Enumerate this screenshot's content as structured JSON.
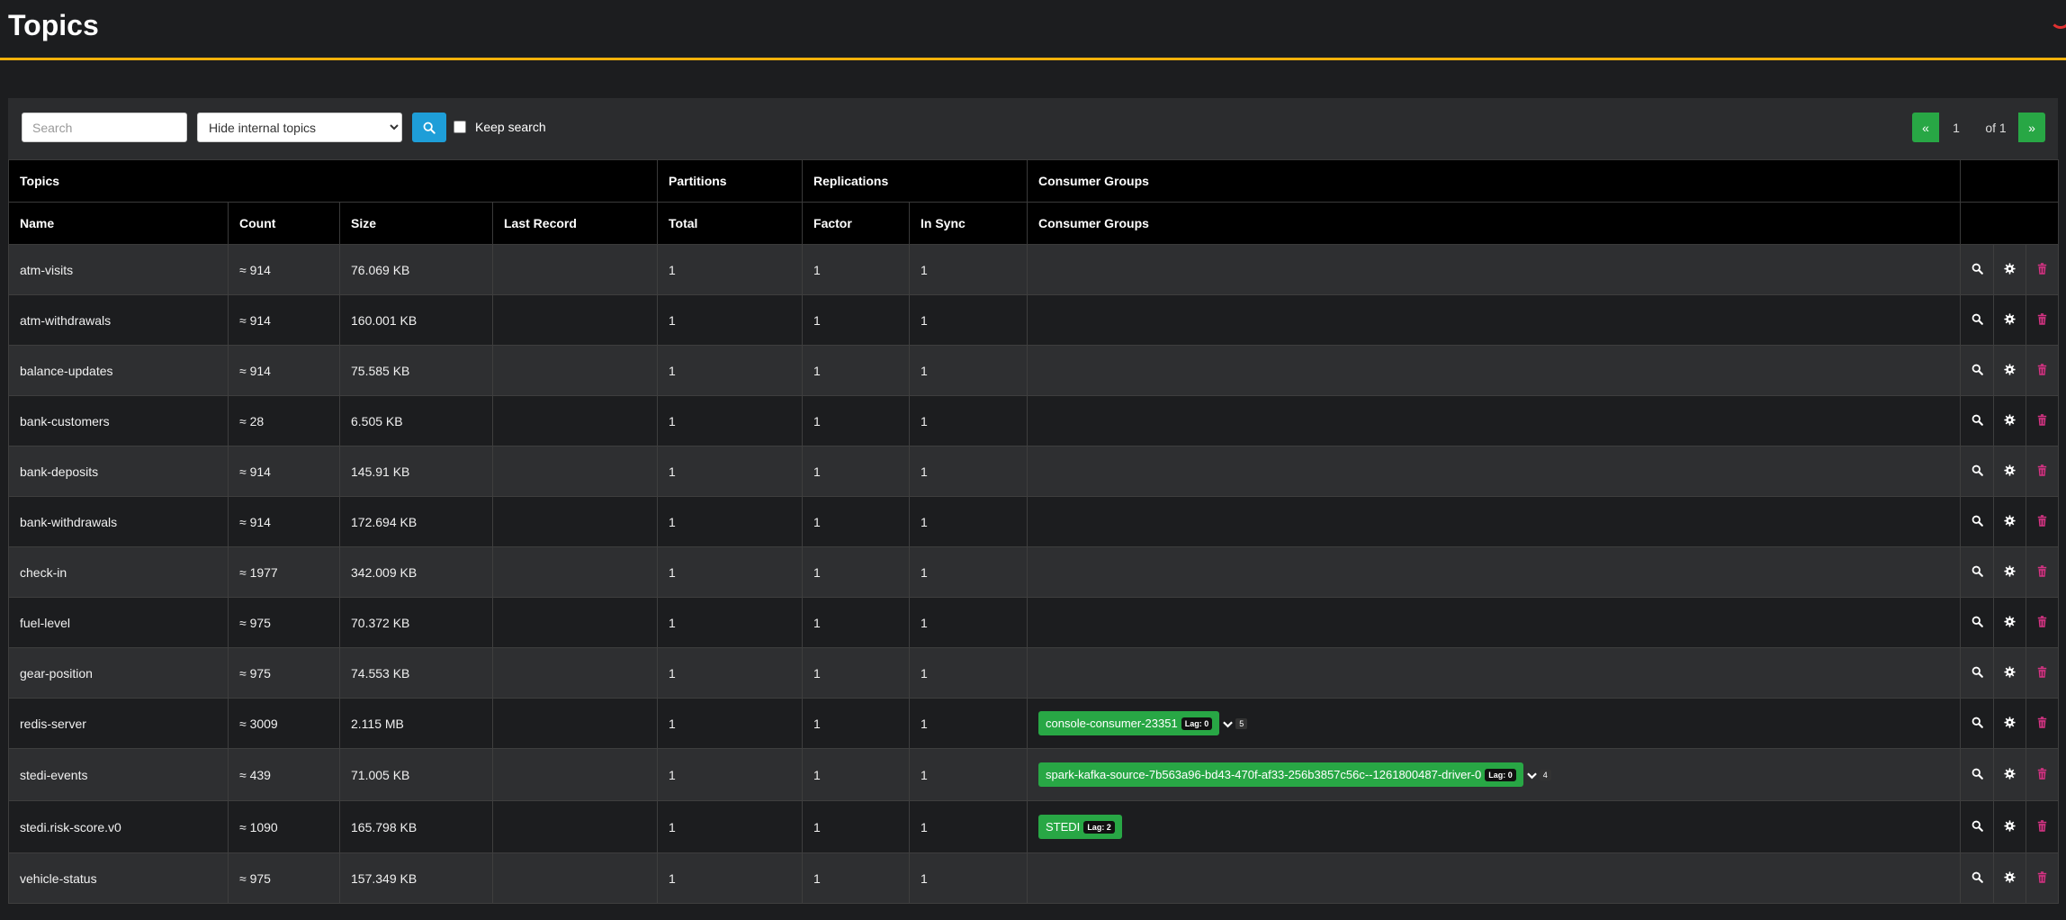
{
  "page": {
    "title": "Topics"
  },
  "toolbar": {
    "search_placeholder": "Search",
    "filter_selected": "Hide internal topics",
    "keep_search_label": "Keep search",
    "keep_search_checked": false
  },
  "pagination": {
    "prev": "«",
    "current": "1",
    "of_label": "of 1",
    "next": "»"
  },
  "table": {
    "group_headers": [
      "Topics",
      "Partitions",
      "Replications",
      "Consumer Groups"
    ],
    "column_headers": [
      "Name",
      "Count",
      "Size",
      "Last Record",
      "Total",
      "Factor",
      "In Sync",
      "Consumer Groups"
    ],
    "rows": [
      {
        "name": "atm-visits",
        "count": "≈ 914",
        "size": "76.069 KB",
        "last_record": "",
        "total": "1",
        "factor": "1",
        "in_sync": "1",
        "consumer_groups": []
      },
      {
        "name": "atm-withdrawals",
        "count": "≈ 914",
        "size": "160.001 KB",
        "last_record": "",
        "total": "1",
        "factor": "1",
        "in_sync": "1",
        "consumer_groups": []
      },
      {
        "name": "balance-updates",
        "count": "≈ 914",
        "size": "75.585 KB",
        "last_record": "",
        "total": "1",
        "factor": "1",
        "in_sync": "1",
        "consumer_groups": []
      },
      {
        "name": "bank-customers",
        "count": "≈ 28",
        "size": "6.505 KB",
        "last_record": "",
        "total": "1",
        "factor": "1",
        "in_sync": "1",
        "consumer_groups": []
      },
      {
        "name": "bank-deposits",
        "count": "≈ 914",
        "size": "145.91 KB",
        "last_record": "",
        "total": "1",
        "factor": "1",
        "in_sync": "1",
        "consumer_groups": []
      },
      {
        "name": "bank-withdrawals",
        "count": "≈ 914",
        "size": "172.694 KB",
        "last_record": "",
        "total": "1",
        "factor": "1",
        "in_sync": "1",
        "consumer_groups": []
      },
      {
        "name": "check-in",
        "count": "≈ 1977",
        "size": "342.009 KB",
        "last_record": "",
        "total": "1",
        "factor": "1",
        "in_sync": "1",
        "consumer_groups": []
      },
      {
        "name": "fuel-level",
        "count": "≈ 975",
        "size": "70.372 KB",
        "last_record": "",
        "total": "1",
        "factor": "1",
        "in_sync": "1",
        "consumer_groups": []
      },
      {
        "name": "gear-position",
        "count": "≈ 975",
        "size": "74.553 KB",
        "last_record": "",
        "total": "1",
        "factor": "1",
        "in_sync": "1",
        "consumer_groups": []
      },
      {
        "name": "redis-server",
        "count": "≈ 3009",
        "size": "2.115 MB",
        "last_record": "",
        "total": "1",
        "factor": "1",
        "in_sync": "1",
        "consumer_groups": [
          {
            "name": "console-consumer-23351",
            "lag": "Lag: 0"
          }
        ],
        "more_count": "5"
      },
      {
        "name": "stedi-events",
        "count": "≈ 439",
        "size": "71.005 KB",
        "last_record": "",
        "total": "1",
        "factor": "1",
        "in_sync": "1",
        "consumer_groups": [
          {
            "name": "spark-kafka-source-7b563a96-bd43-470f-af33-256b3857c56c--1261800487-driver-0",
            "lag": "Lag: 0"
          }
        ],
        "more_count": "4"
      },
      {
        "name": "stedi.risk-score.v0",
        "count": "≈ 1090",
        "size": "165.798 KB",
        "last_record": "",
        "total": "1",
        "factor": "1",
        "in_sync": "1",
        "consumer_groups": [
          {
            "name": "STEDI",
            "lag": "Lag: 2"
          }
        ]
      },
      {
        "name": "vehicle-status",
        "count": "≈ 975",
        "size": "157.349 KB",
        "last_record": "",
        "total": "1",
        "factor": "1",
        "in_sync": "1",
        "consumer_groups": []
      }
    ]
  },
  "icons": {
    "search": "search-icon",
    "settings": "gear-icon",
    "delete": "trash-icon",
    "expand": "chevron-down-icon"
  },
  "colors": {
    "accent": "#f4b10a",
    "success": "#28a745",
    "primary": "#1e9ed8",
    "danger": "#d63384"
  }
}
